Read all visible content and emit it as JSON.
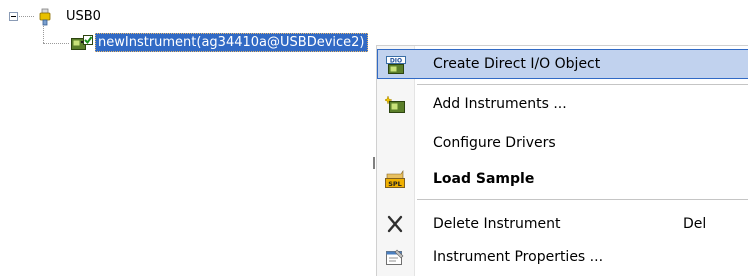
{
  "tree": {
    "root_label": "USB0",
    "child_label": "newInstrument(ag34410a@USBDevice2)"
  },
  "menu": {
    "items": [
      {
        "label": "Create Direct I/O Object",
        "icon": "dio-icon",
        "highlighted": true
      },
      {
        "label": "Add Instruments ...",
        "icon": "add-instrument-icon"
      },
      {
        "label": "Configure Drivers",
        "icon": ""
      },
      {
        "label": "Load Sample",
        "icon": "spl-sample-icon",
        "bold": true
      },
      {
        "label": "Delete Instrument",
        "icon": "delete-x-icon",
        "shortcut": "Del"
      },
      {
        "label": "Instrument Properties ...",
        "icon": "properties-icon"
      }
    ]
  },
  "colors": {
    "selection": "#316ac5",
    "menu_highlight": "#c1d2ee"
  }
}
